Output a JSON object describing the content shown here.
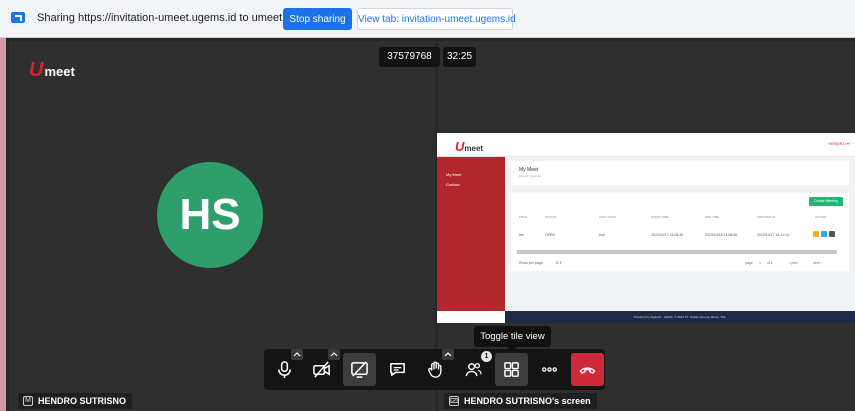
{
  "share_bar": {
    "text": "Sharing https://invitation-umeet.ugems.id to umeet.ugems.id",
    "stop_label": "Stop sharing",
    "view_tab_label": "View tab: invitation-umeet.ugems.id"
  },
  "meeting": {
    "logo_u": "U",
    "logo_meet": "meet",
    "meeting_id": "37579768",
    "timer": "32:25"
  },
  "participant": {
    "initials": "HS",
    "name": "HENDRO SUTRISNO",
    "name_icon": "M"
  },
  "screen_share": {
    "name": "HENDRO SUTRISNO's screen",
    "app_logo_u": "U",
    "app_logo_meet": "meet",
    "user_menu": "HENDRO ▾",
    "sidebar": [
      "My Meet",
      "Contact"
    ],
    "card_title": "My Meet",
    "card_subtitle": "All your meet list",
    "create_label": "Create Meeting",
    "columns": [
      "TITLE",
      "STATUS",
      "ONLY COST",
      "START TIME",
      "END TIME",
      "CREATED AT",
      "ACTION"
    ],
    "row": [
      "tes",
      "OPEN",
      "true",
      "2022/10/17 14:08:40",
      "2022/10/18 14:08:46",
      "2022/10/17 14:11:14"
    ],
    "rows_per_page_label": "Rows per page:",
    "rows_per_page_value": "10 ▾",
    "page_label": "page",
    "page_value": "1",
    "page_of": "of 1",
    "prev_label": "‹ prev",
    "next_label": "next ›",
    "footer": "Provided by Digitech - GEMS. © 2022 PT. Golden Energy Mines, Tbk."
  },
  "tooltip": "Toggle tile view",
  "toolbar": {
    "participants_count": "1"
  },
  "colors": {
    "avatar": "#2e9e6b",
    "brand_red": "#d8232a",
    "hangup": "#cf2a3a",
    "chrome_blue": "#1a73e8"
  }
}
